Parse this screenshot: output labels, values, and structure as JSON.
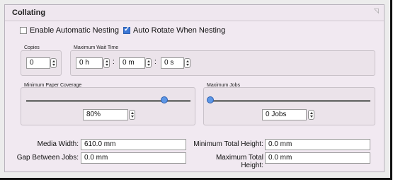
{
  "panel": {
    "title": "Collating"
  },
  "options": {
    "auto_nesting": {
      "label": "Enable Automatic Nesting",
      "checked": false
    },
    "auto_rotate": {
      "label": "Auto Rotate When Nesting",
      "checked": true
    }
  },
  "copies": {
    "label": "Copies",
    "value": "0"
  },
  "wait_time": {
    "label": "Maximum Wait Time",
    "hours": "0 h",
    "minutes": "0 m",
    "seconds": "0 s",
    "separator": ":"
  },
  "paper_coverage": {
    "label": "Minimum Paper Coverage",
    "value": "80%",
    "slider_fraction": 0.8
  },
  "max_jobs": {
    "label": "Maximum Jobs",
    "value": "0 Jobs",
    "slider_fraction": 0.0
  },
  "dimensions": {
    "media_width_label": "Media Width:",
    "media_width_value": "610.0 mm",
    "gap_label": "Gap Between Jobs:",
    "gap_value": "0.0 mm",
    "min_total_height_label": "Minimum Total Height:",
    "min_total_height_value": "0.0 mm",
    "max_total_height_label": "Maximum Total Height:",
    "max_total_height_value": "0.0 mm"
  },
  "colors": {
    "accent": "#3d78d6",
    "panel_bg": "#f1e9f1"
  },
  "icons": {
    "corner": "resize-corner-icon"
  }
}
